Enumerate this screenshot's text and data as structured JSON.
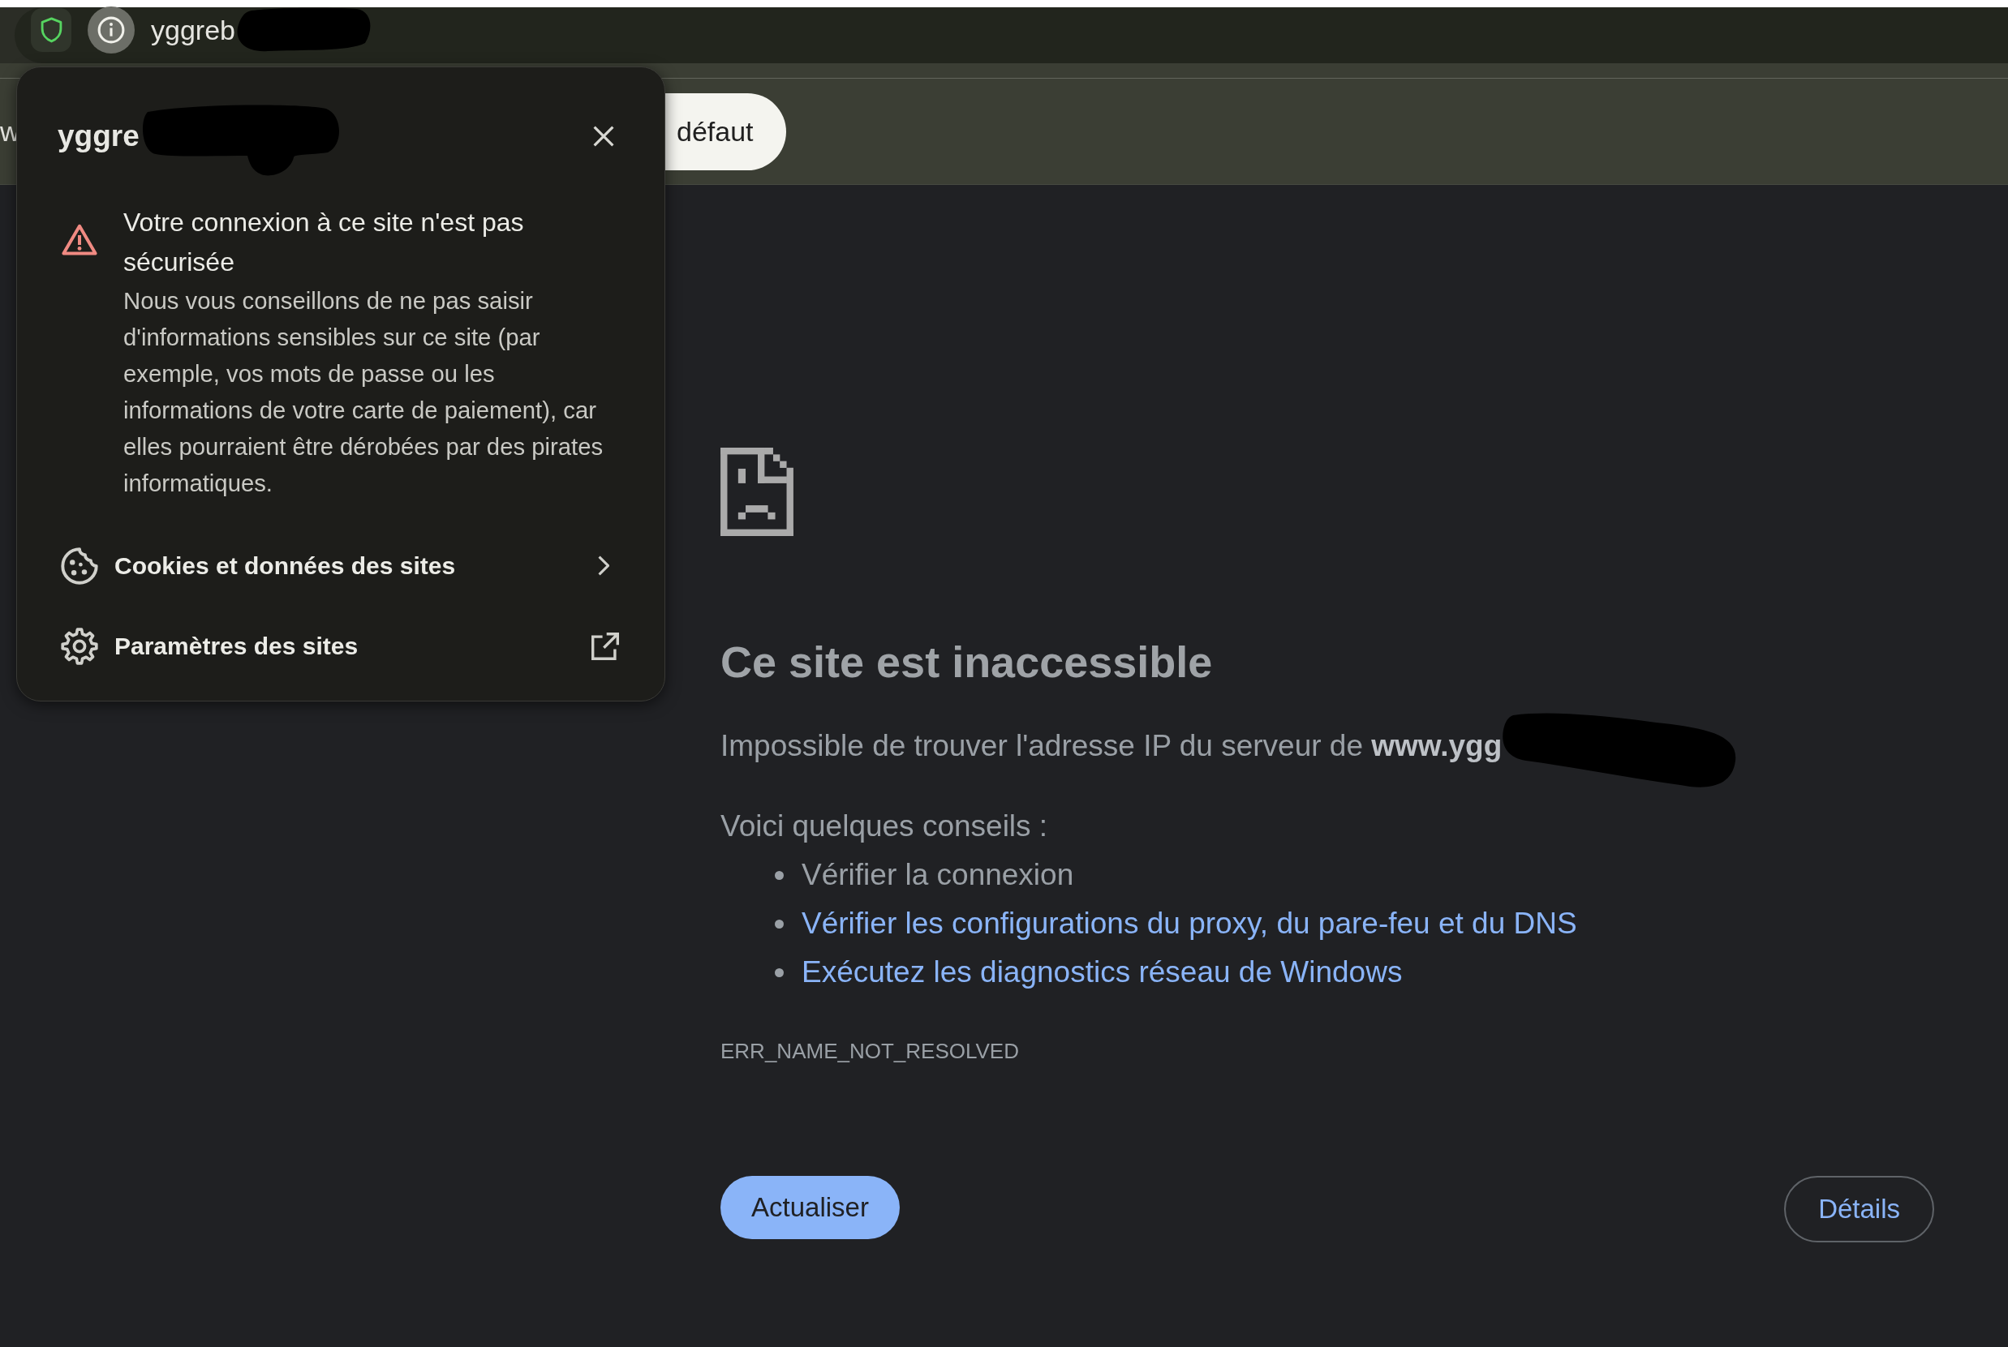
{
  "address_bar": {
    "url": "yggreb"
  },
  "infobar": {
    "text": "w",
    "button": "défaut"
  },
  "site_info": {
    "title": "yggre",
    "warning": {
      "heading": "Votre connexion à ce site n'est pas sécurisée",
      "body": "Nous vous conseillons de ne pas saisir d'informations sensibles sur ce site (par exemple, vos mots de passe ou les informations de votre carte de paiement), car elles pourraient être dérobées par des pirates informatiques."
    },
    "items": [
      {
        "kind": "submenu",
        "label": "Cookies et données des sites"
      },
      {
        "kind": "external",
        "label": "Paramètres des sites"
      }
    ]
  },
  "error_page": {
    "title": "Ce site est inaccessible",
    "message": "Impossible de trouver l'adresse IP du serveur de **www.ygg**",
    "tips_heading": "Voici quelques conseils :",
    "tips": [
      {
        "kind": "text",
        "text": "Vérifier la connexion"
      },
      {
        "kind": "link",
        "text": "Vérifier les configurations du proxy, du pare-feu et du DNS"
      },
      {
        "kind": "link",
        "text": "Exécutez les diagnostics réseau de Windows"
      }
    ],
    "error_code": "ERR_NAME_NOT_RESOLVED",
    "buttons": [
      {
        "kind": "primary",
        "label": "Actualiser"
      },
      {
        "kind": "secondary",
        "label": "Détails"
      }
    ]
  }
}
